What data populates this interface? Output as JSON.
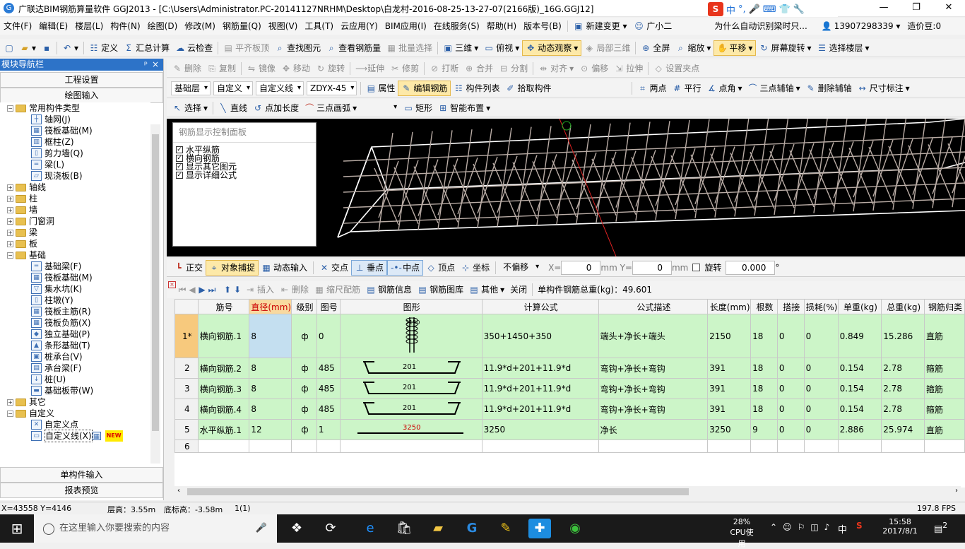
{
  "window": {
    "title": "广联达BIM钢筋算量软件 GGJ2013 - [C:\\Users\\Administrator.PC-20141127NRHM\\Desktop\\白龙村-2016-08-25-13-27-07(2166版)_16G.GGJ12]",
    "ime": [
      "中",
      "°,",
      "🎤",
      "⌨",
      "👕",
      "🔧"
    ]
  },
  "menu": [
    "文件(F)",
    "编辑(E)",
    "楼层(L)",
    "构件(N)",
    "绘图(D)",
    "修改(M)",
    "钢筋量(Q)",
    "视图(V)",
    "工具(T)",
    "云应用(Y)",
    "BIM应用(I)",
    "在线服务(S)",
    "帮助(H)",
    "版本号(B)"
  ],
  "menu_extra": {
    "new_change": "新建变更",
    "assistant": "广小二",
    "question": "为什么自动识别梁时只...",
    "phone": "13907298339",
    "price": "造价豆:0"
  },
  "tb1": [
    {
      "t": "定义",
      "i": "☷"
    },
    {
      "t": "汇总计算",
      "i": "Σ"
    },
    {
      "t": "云检查",
      "i": "☁"
    },
    {
      "t": "平齐板顶",
      "i": "▤",
      "d": true
    },
    {
      "t": "查找图元",
      "i": "⌕"
    },
    {
      "t": "查看钢筋量",
      "i": "⌕"
    },
    {
      "t": "批量选择",
      "i": "▦",
      "d": true
    },
    {
      "t": "三维",
      "i": "▣"
    },
    {
      "t": "俯视",
      "i": "▭"
    },
    {
      "t": "动态观察",
      "i": "✥",
      "a": true
    },
    {
      "t": "局部三维",
      "i": "◈",
      "d": true
    },
    {
      "t": "全屏",
      "i": "⊕"
    },
    {
      "t": "缩放",
      "i": "⌕"
    },
    {
      "t": "平移",
      "i": "✋",
      "a": true
    },
    {
      "t": "屏幕旋转",
      "i": "↻"
    },
    {
      "t": "选择楼层",
      "i": "☰"
    }
  ],
  "tb2": [
    "删除",
    "复制",
    "镜像",
    "移动",
    "旋转",
    "延伸",
    "修剪",
    "打断",
    "合并",
    "分割",
    "对齐",
    "偏移",
    "拉伸",
    "设置夹点"
  ],
  "tb3": {
    "floor": "基础层",
    "type": "自定义",
    "line": "自定义线",
    "code": "ZDYX-45",
    "btns": [
      "属性",
      "编辑钢筋",
      "构件列表",
      "拾取构件"
    ],
    "right": [
      "两点",
      "平行",
      "点角",
      "三点辅轴",
      "删除辅轴",
      "尺寸标注"
    ]
  },
  "tb4": [
    "选择",
    "直线",
    "点加长度",
    "三点画弧",
    "矩形",
    "智能布置"
  ],
  "nav": {
    "title": "模块导航栏",
    "pin": "ᵖ",
    "close": "×",
    "top": [
      "工程设置",
      "绘图输入"
    ],
    "bottom": [
      "单构件输入",
      "报表预览"
    ],
    "tree": [
      {
        "l": 0,
        "e": "−",
        "f": 1,
        "t": "常用构件类型"
      },
      {
        "l": 1,
        "c": "┼",
        "t": "轴网(J)"
      },
      {
        "l": 1,
        "c": "▦",
        "t": "筏板基础(M)"
      },
      {
        "l": 1,
        "c": "▥",
        "t": "框柱(Z)"
      },
      {
        "l": 1,
        "c": "▯",
        "t": "剪力墙(Q)"
      },
      {
        "l": 1,
        "c": "═",
        "t": "梁(L)"
      },
      {
        "l": 1,
        "c": "▱",
        "t": "现浇板(B)"
      },
      {
        "l": 0,
        "e": "+",
        "f": 1,
        "t": "轴线"
      },
      {
        "l": 0,
        "e": "+",
        "f": 1,
        "t": "柱"
      },
      {
        "l": 0,
        "e": "+",
        "f": 1,
        "t": "墙"
      },
      {
        "l": 0,
        "e": "+",
        "f": 1,
        "t": "门窗洞"
      },
      {
        "l": 0,
        "e": "+",
        "f": 1,
        "t": "梁"
      },
      {
        "l": 0,
        "e": "+",
        "f": 1,
        "t": "板"
      },
      {
        "l": 0,
        "e": "−",
        "f": 1,
        "t": "基础"
      },
      {
        "l": 1,
        "c": "═",
        "t": "基础梁(F)"
      },
      {
        "l": 1,
        "c": "▦",
        "t": "筏板基础(M)"
      },
      {
        "l": 1,
        "c": "▽",
        "t": "集水坑(K)"
      },
      {
        "l": 1,
        "c": "▯",
        "t": "柱墩(Y)"
      },
      {
        "l": 1,
        "c": "▦",
        "t": "筏板主筋(R)"
      },
      {
        "l": 1,
        "c": "▦",
        "t": "筏板负筋(X)"
      },
      {
        "l": 1,
        "c": "◆",
        "t": "独立基础(P)"
      },
      {
        "l": 1,
        "c": "▲",
        "t": "条形基础(T)"
      },
      {
        "l": 1,
        "c": "▣",
        "t": "桩承台(V)"
      },
      {
        "l": 1,
        "c": "▤",
        "t": "承台梁(F)"
      },
      {
        "l": 1,
        "c": "↓",
        "t": "桩(U)"
      },
      {
        "l": 1,
        "c": "▬",
        "t": "基础板带(W)"
      },
      {
        "l": 0,
        "e": "+",
        "f": 1,
        "t": "其它"
      },
      {
        "l": 0,
        "e": "−",
        "f": 1,
        "t": "自定义"
      },
      {
        "l": 1,
        "c": "✕",
        "t": "自定义点"
      },
      {
        "l": 1,
        "c": "▭",
        "t": "自定义线(X)",
        "new": "NEW"
      }
    ]
  },
  "ctrl": {
    "title": "钢筋显示控制面板",
    "items": [
      "水平纵筋",
      "横向钢筋",
      "显示其它图元",
      "显示详细公式"
    ],
    "check": "✓"
  },
  "snap": {
    "btns": [
      "正交",
      "对象捕捉",
      "动态输入",
      "交点",
      "垂点",
      "中点",
      "顶点",
      "坐标"
    ],
    "offset": "不偏移",
    "x_label": "X=",
    "x": "0",
    "y_label": "mm Y=",
    "y": "0",
    "mm": "mm",
    "rotate": "旋转",
    "angle": "0.000",
    "deg": "°"
  },
  "gridtb": {
    "btns": [
      "插入",
      "删除",
      "缩尺配筋",
      "钢筋信息",
      "钢筋图库",
      "其他",
      "关闭"
    ],
    "total": "单构件钢筋总重(kg)：49.601"
  },
  "grid": {
    "headers": [
      "",
      "筋号",
      "直径(mm)",
      "级别",
      "图号",
      "图形",
      "计算公式",
      "公式描述",
      "长度(mm)",
      "根数",
      "搭接",
      "损耗(%)",
      "单重(kg)",
      "总重(kg)",
      "钢筋归类"
    ],
    "rows": [
      {
        "n": "1*",
        "c": [
          "横向钢筋.1",
          "8",
          "ф",
          "0",
          "",
          "350+1450+350",
          "端头+净长+端头",
          "2150",
          "18",
          "0",
          "0",
          "0.849",
          "15.286",
          "直筋"
        ],
        "shape": "stack"
      },
      {
        "n": "2",
        "c": [
          "横向钢筋.2",
          "8",
          "ф",
          "485",
          "201",
          "11.9*d+201+11.9*d",
          "弯钩+净长+弯钩",
          "391",
          "18",
          "0",
          "0",
          "0.154",
          "2.78",
          "箍筋"
        ],
        "shape": "hook"
      },
      {
        "n": "3",
        "c": [
          "横向钢筋.3",
          "8",
          "ф",
          "485",
          "201",
          "11.9*d+201+11.9*d",
          "弯钩+净长+弯钩",
          "391",
          "18",
          "0",
          "0",
          "0.154",
          "2.78",
          "箍筋"
        ],
        "shape": "hook"
      },
      {
        "n": "4",
        "c": [
          "横向钢筋.4",
          "8",
          "ф",
          "485",
          "201",
          "11.9*d+201+11.9*d",
          "弯钩+净长+弯钩",
          "391",
          "18",
          "0",
          "0",
          "0.154",
          "2.78",
          "箍筋"
        ],
        "shape": "hook"
      },
      {
        "n": "5",
        "c": [
          "水平纵筋.1",
          "12",
          "ф",
          "1",
          "3250",
          "3250",
          "净长",
          "3250",
          "9",
          "0",
          "0",
          "2.886",
          "25.974",
          "直筋"
        ],
        "shape": "line"
      },
      {
        "n": "6",
        "c": [
          "",
          "",
          "",
          "",
          "",
          "",
          "",
          "",
          "",
          "",
          "",
          "",
          "",
          ""
        ],
        "shape": "none"
      }
    ]
  },
  "status": {
    "xy": "X=43558 Y=4146",
    "floor_h": "层高：3.55m",
    "bottom_h": "底标高：-3.58m",
    "count": "1(1)",
    "fps": "197.8 FPS"
  },
  "taskbar": {
    "search": "在这里输入你要搜索的内容",
    "cpu": "28%",
    "cpu_label": "CPU使用",
    "lang": "中",
    "time": "15:58",
    "date": "2017/8/1",
    "notif": "2"
  }
}
